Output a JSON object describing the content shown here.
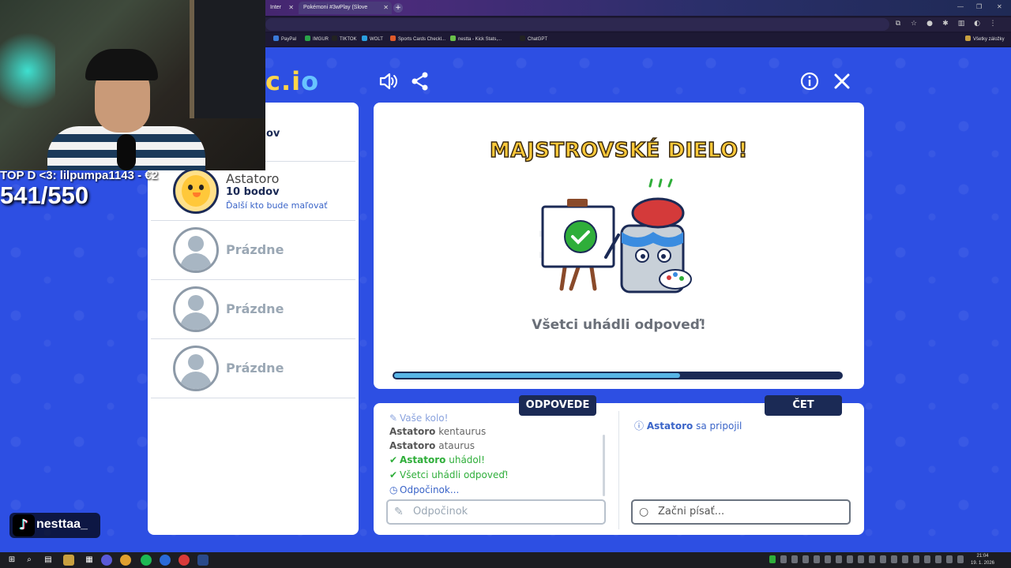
{
  "browser": {
    "tabs": [
      {
        "title": "Inter"
      },
      {
        "title": "Pokémoni #3wPlay (Slove"
      }
    ],
    "bookmarks": [
      "PayPal",
      "IMGUR",
      "TIKTOK",
      "WOLT",
      "Sports Cards Checkl...",
      "nestta - Kick Stats,...",
      "ChatGPT"
    ],
    "all_bookmarks": "Všetky záložky"
  },
  "game": {
    "logo": {
      "main": "c.i",
      "accent": "o"
    },
    "players": [
      {
        "partial_label": "ov"
      },
      {
        "name": "Astatoro",
        "points": "10 bodov",
        "note": "Ďalší kto bude maľovať"
      },
      {
        "name": "Prázdne"
      },
      {
        "name": "Prázdne"
      },
      {
        "name": "Prázdne"
      }
    ],
    "headline": "MAJSTROVSKÉ DIELO!",
    "subtitle": "Všetci uhádli odpoveď!",
    "progress": 0.64,
    "answers_tab": "ODPOVEDE",
    "chat_tab": "ČET",
    "answers": [
      {
        "user": "",
        "text": "Vaše kolo!"
      },
      {
        "user": "Astatoro",
        "text": "kentaurus"
      },
      {
        "user": "Astatoro",
        "text": "ataurus"
      },
      {
        "user": "Astatoro",
        "text": "uhádol!"
      },
      {
        "user": "",
        "text": "Všetci uhádli odpoveď!"
      },
      {
        "user": "",
        "text": "Odpočinok..."
      }
    ],
    "answer_placeholder": "Odpočinok",
    "chat_message": {
      "user": "Astatoro",
      "text": "sa pripojil"
    },
    "chat_placeholder": "Začni písať..."
  },
  "stream": {
    "top_donor": "TOP D <3: lilpumpa1143 - €2",
    "counter": "541/550",
    "tiktok_name": "nesttaa_"
  },
  "taskbar": {
    "time": "21:04",
    "date": "19. 1. 2026"
  },
  "colors": {
    "background": "#2d4fe3",
    "navy": "#1b2a55",
    "headline": "#ffc93a",
    "green": "#2fae3a",
    "link": "#3a64c8"
  }
}
